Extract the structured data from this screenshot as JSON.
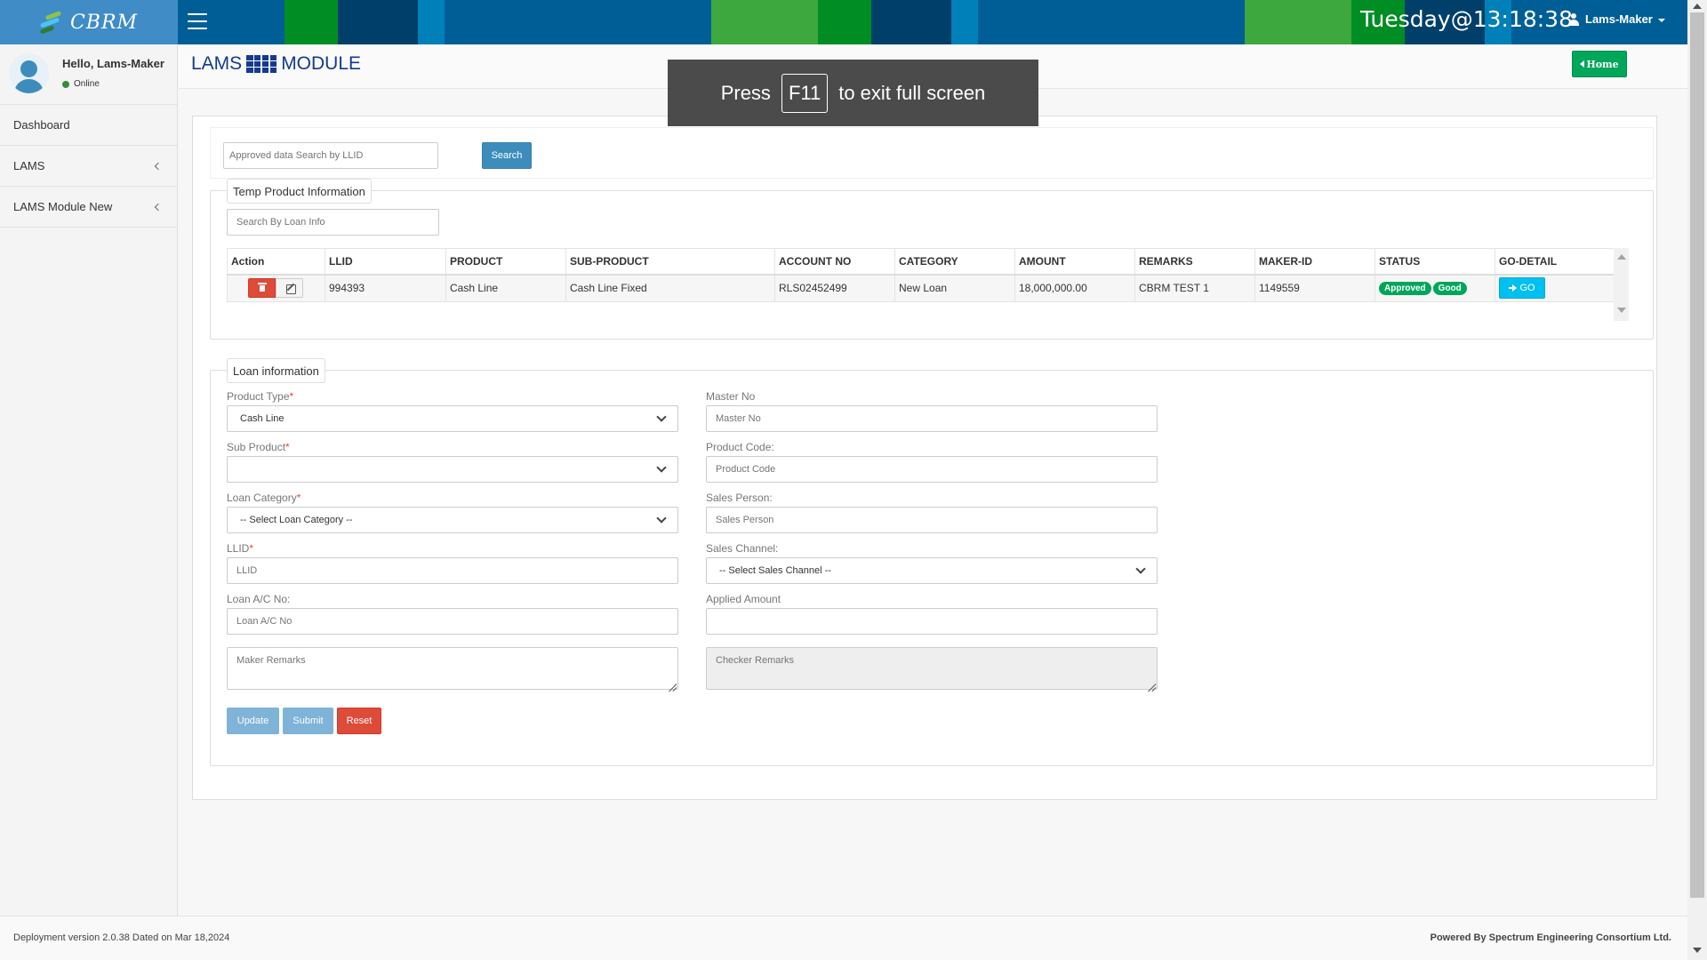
{
  "header": {
    "brand": "CBRM",
    "clock": "Tuesday@13:18:38",
    "user_menu": "Lams-Maker",
    "stripe_colors": [
      "#3da83d",
      "#008d24",
      "#003f6a",
      "#0080b8"
    ]
  },
  "sidebar": {
    "greeting": "Hello, Lams-Maker",
    "status": "Online",
    "items": [
      {
        "label": "Dashboard"
      },
      {
        "label": "LAMS"
      },
      {
        "label": "LAMS Module New"
      }
    ]
  },
  "content_header": {
    "title_left": "LAMS",
    "title_right": "MODULE",
    "home_label": "Home"
  },
  "search": {
    "placeholder": "Approved data Search by LLID",
    "button": "Search"
  },
  "temp_product": {
    "legend": "Temp Product Information",
    "search_placeholder": "Search By Loan Info",
    "columns": [
      "Action",
      "LLID",
      "PRODUCT",
      "SUB-PRODUCT",
      "ACCOUNT NO",
      "CATEGORY",
      "AMOUNT",
      "REMARKS",
      "MAKER-ID",
      "STATUS",
      "GO-DETAIL"
    ],
    "rows": [
      {
        "llid": "994393",
        "product": "Cash Line",
        "sub_product": "Cash Line Fixed",
        "account_no": "RLS02452499",
        "category": "New Loan",
        "amount": "18,000,000.00",
        "remarks": "CBRM TEST 1",
        "maker_id": "1149559",
        "status_badges": [
          "Approved",
          "Good"
        ],
        "go_label": "GO"
      }
    ]
  },
  "loan_info": {
    "legend": "Loan information",
    "product_type": {
      "label": "Product Type",
      "value": "Cash Line"
    },
    "sub_product": {
      "label": "Sub Product",
      "value": ""
    },
    "loan_category": {
      "label": "Loan Category",
      "value": "-- Select Loan Category --"
    },
    "llid": {
      "label": "LLID",
      "placeholder": "LLID"
    },
    "loan_ac_no": {
      "label": "Loan A/C No:",
      "placeholder": "Loan A/C No"
    },
    "maker_remarks": {
      "placeholder": "Maker Remarks"
    },
    "master_no": {
      "label": "Master No",
      "placeholder": "Master No"
    },
    "product_code": {
      "label": "Product Code:",
      "placeholder": "Product Code"
    },
    "sales_person": {
      "label": "Sales Person:",
      "placeholder": "Sales Person"
    },
    "sales_channel": {
      "label": "Sales Channel:",
      "value": "-- Select Sales Channel --"
    },
    "applied_amount": {
      "label": "Applied Amount",
      "placeholder": ""
    },
    "checker_remarks": {
      "placeholder": "Checker Remarks"
    },
    "buttons": {
      "update": "Update",
      "submit": "Submit",
      "reset": "Reset"
    }
  },
  "footer": {
    "left": "Deployment version 2.0.38 Dated on Mar 18,2024",
    "right": "Powered By Spectrum Engineering Consortium Ltd."
  },
  "overlay": {
    "prefix": "Press",
    "key": "F11",
    "suffix": "to exit full screen"
  }
}
